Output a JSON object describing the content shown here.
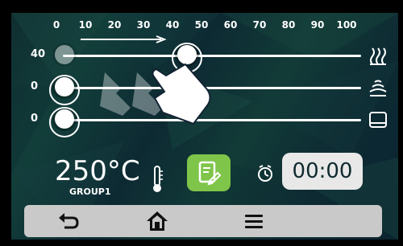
{
  "scale": {
    "ticks": [
      "0",
      "10",
      "20",
      "30",
      "40",
      "50",
      "60",
      "70",
      "80",
      "90",
      "100"
    ]
  },
  "sliders": [
    {
      "label": "40",
      "icon": "heat-waves-icon",
      "value": 40
    },
    {
      "label": "0",
      "icon": "steam-icon",
      "value": 0
    },
    {
      "label": "0",
      "icon": "base-heat-icon",
      "value": 0
    }
  ],
  "status": {
    "temperature": "250°C",
    "group": "GROUP1",
    "timer": "00:00"
  },
  "icons": {
    "thermometer": "thermometer-icon",
    "edit": "edit-recipe-icon",
    "timer": "timer-icon",
    "back": "back-icon",
    "home": "home-icon",
    "menu": "menu-icon"
  },
  "colors": {
    "accent": "#7fc54a",
    "slider": "#ffffff",
    "timerbox": "#e8e8e8",
    "navbar": "#c9c9c9"
  }
}
